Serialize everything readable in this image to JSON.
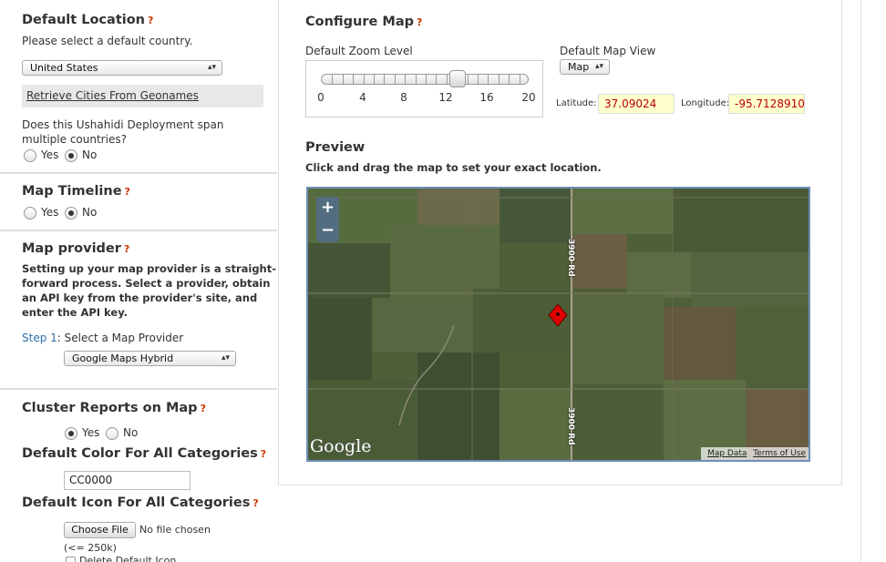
{
  "left": {
    "default_location": {
      "title": "Default Location",
      "help": "?",
      "prompt": "Please select a default country.",
      "country_value": "United States",
      "geonames_link": "Retrieve Cities From Geonames",
      "multi_country_q": "Does this Ushahidi Deployment span multiple countries?",
      "yes": "Yes",
      "no": "No",
      "selected": "No"
    },
    "map_timeline": {
      "title": "Map Timeline",
      "help": "?",
      "yes": "Yes",
      "no": "No",
      "selected": "No"
    },
    "map_provider": {
      "title": "Map provider",
      "help": "?",
      "desc": "Setting up your map provider is a straight-forward process. Select a provider, obtain an API key from the provider's site, and enter the API key.",
      "step_label": "Step 1",
      "step_text": ": Select a Map Provider",
      "provider_value": "Google Maps Hybrid"
    },
    "cluster": {
      "title": "Cluster Reports on Map",
      "help": "?",
      "yes": "Yes",
      "no": "No",
      "selected": "Yes"
    },
    "default_color": {
      "title": "Default Color For All Categories",
      "help": "?",
      "value": "CC0000"
    },
    "default_icon": {
      "title": "Default Icon For All Categories",
      "help": "?",
      "choose_file": "Choose File",
      "no_file": "No file chosen",
      "size_note": "(<= 250k)",
      "delete_label": "Delete Default Icon"
    }
  },
  "right": {
    "configure_title": "Configure Map",
    "help": "?",
    "zoom_label": "Default Zoom Level",
    "zoom_ticks": [
      "0",
      "4",
      "8",
      "12",
      "16",
      "20"
    ],
    "zoom_value": 13,
    "map_view_label": "Default Map View",
    "map_view_value": "Map",
    "latitude_label": "Latitude:",
    "latitude_value": "37.09024",
    "longitude_label": "Longitude:",
    "longitude_value": "-95.7128910",
    "preview_title": "Preview",
    "preview_hint": "Click and drag the map to set your exact location.",
    "map": {
      "zoom_in": "+",
      "zoom_out": "−",
      "road_label_1": "3900 Rd",
      "road_label_2": "3900 Rd",
      "logo": "Google",
      "map_data": "Map Data",
      "terms": "Terms of Use"
    }
  },
  "colors": {
    "help_red": "#cc3300",
    "link_blue": "#2f6fad",
    "coord_bg": "#ffffcc",
    "coord_text": "#bb0000",
    "map_border": "#6d8fb8",
    "marker_red": "#e00000"
  }
}
